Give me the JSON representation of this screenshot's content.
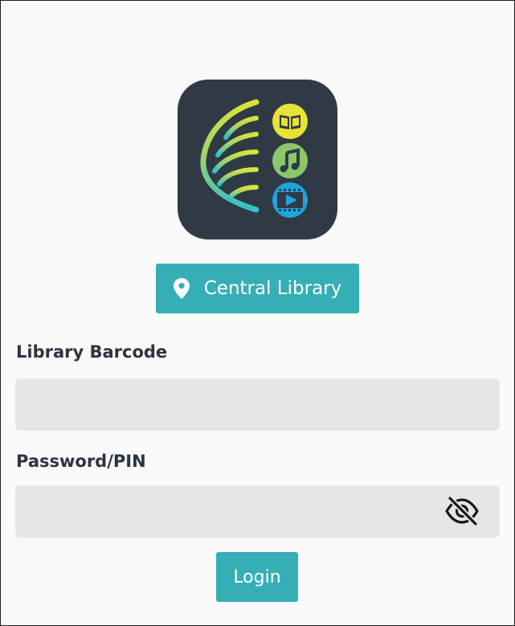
{
  "app": {
    "logo_icon": "library-leaf-logo-icon",
    "logo_sub_icons": [
      "book-icon",
      "music-note-icon",
      "video-play-icon"
    ],
    "colors": {
      "accent": "#36aeb5",
      "logo_background": "#2f3a45",
      "input_background": "#e6e6e6",
      "label_text": "#2b3440"
    }
  },
  "location": {
    "icon": "map-pin-icon",
    "label": "Central Library"
  },
  "form": {
    "barcode_label": "Library Barcode",
    "barcode_value": "",
    "barcode_placeholder": "",
    "pin_label": "Password/PIN",
    "pin_value": "",
    "pin_placeholder": "",
    "pin_visibility_icon": "eye-off-icon",
    "login_label": "Login"
  }
}
